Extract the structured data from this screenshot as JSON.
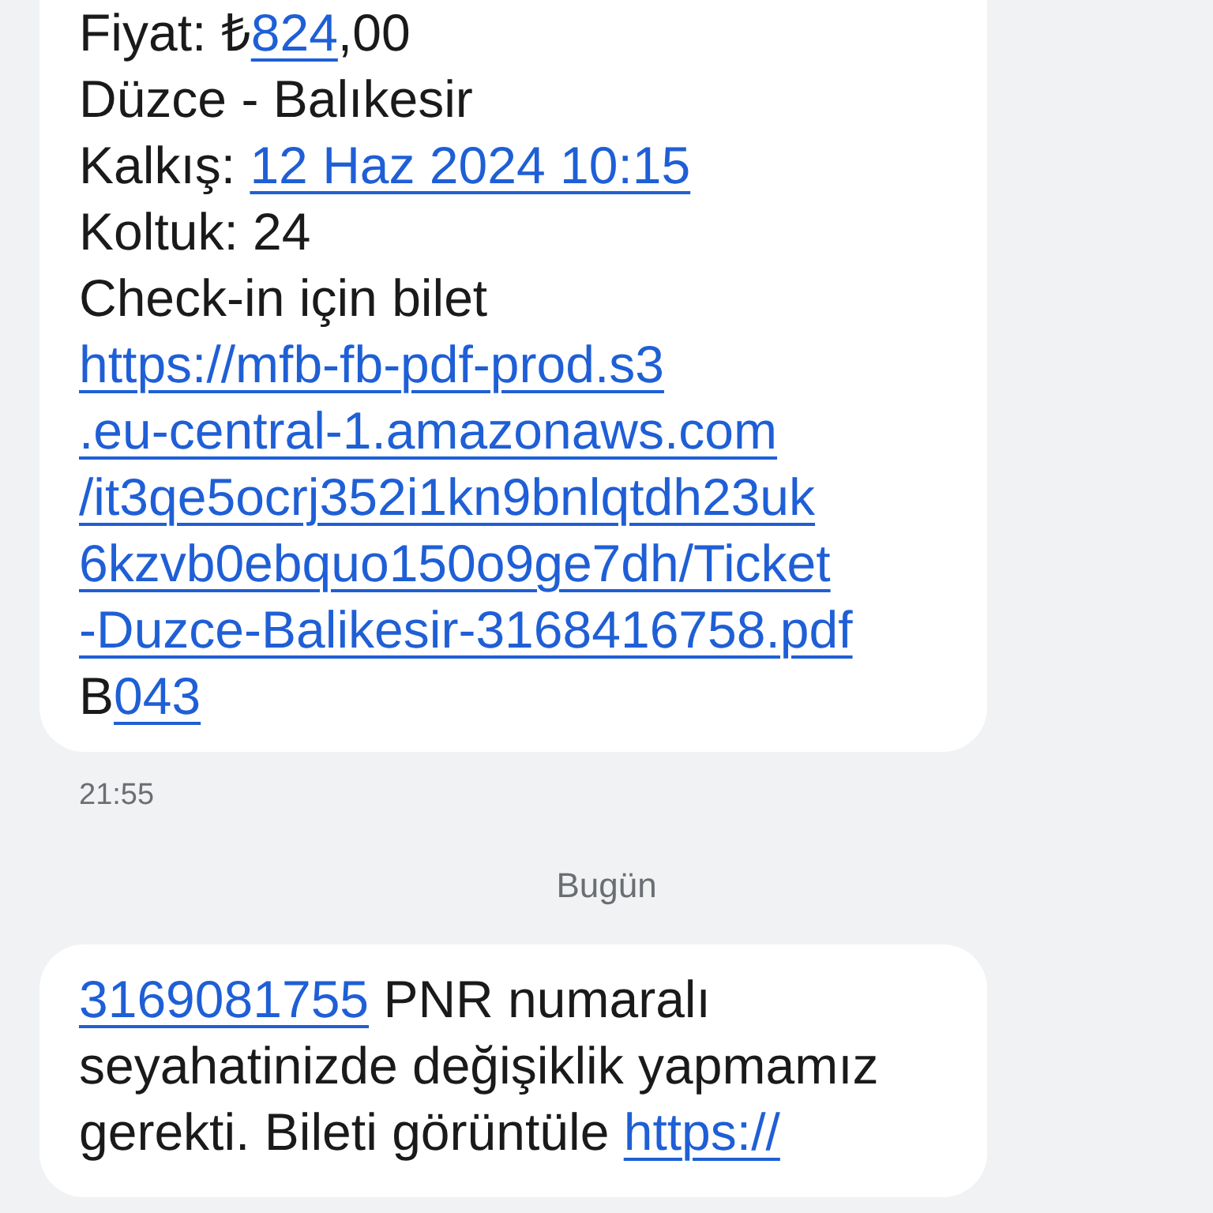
{
  "messages": [
    {
      "lines": [
        [
          {
            "text": "Fiyat: ₺",
            "link": false
          },
          {
            "text": "824",
            "link": true
          },
          {
            "text": ",00",
            "link": false
          }
        ],
        [
          {
            "text": "Düzce - Balıkesir",
            "link": false
          }
        ],
        [
          {
            "text": "Kalkış: ",
            "link": false
          },
          {
            "text": "12 Haz 2024 10:15",
            "link": true
          }
        ],
        [
          {
            "text": "Koltuk: 24",
            "link": false
          }
        ],
        [
          {
            "text": "Check-in için bilet",
            "link": false
          }
        ],
        [
          {
            "text": "https://mfb-fb-pdf-prod.s3",
            "link": true
          }
        ],
        [
          {
            "text": ".eu-central-1.amazonaws.com",
            "link": true
          }
        ],
        [
          {
            "text": "/it3qe5ocrj352i1kn9bnlqtdh23uk",
            "link": true
          }
        ],
        [
          {
            "text": "6kzvb0ebquo150o9ge7dh/Ticket",
            "link": true
          }
        ],
        [
          {
            "text": "-Duzce-Balikesir-3168416758.pdf",
            "link": true
          }
        ],
        [
          {
            "text": "B",
            "link": false
          },
          {
            "text": "043",
            "link": true
          }
        ]
      ],
      "time": "21:55"
    },
    {
      "date_separator": "Bugün",
      "lines": [
        [
          {
            "text": "3169081755",
            "link": true
          },
          {
            "text": " PNR numaralı",
            "link": false
          }
        ],
        [
          {
            "text": "seyahatinizde değişiklik yapmamız",
            "link": false
          }
        ],
        [
          {
            "text": "gerekti. Bileti görüntüle ",
            "link": false
          },
          {
            "text": "https://",
            "link": true
          }
        ]
      ]
    }
  ]
}
